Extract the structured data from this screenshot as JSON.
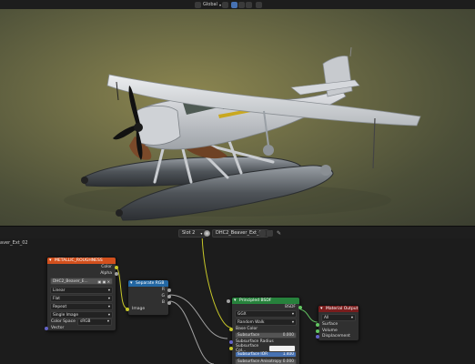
{
  "header": {
    "orientation": "Global",
    "icons": [
      "transform-icon",
      "pivot-icon",
      "snap-icon",
      "snap-toggle-icon",
      "proportional-icon"
    ]
  },
  "viewport": {
    "background_colors": [
      "#8c8650",
      "#6c6b45",
      "#3b3e30"
    ],
    "aircraft_color": "#d7d9dc"
  },
  "node_header": {
    "slot": "Slot 2",
    "material": "DHC2_Beaver_Ext_02",
    "user_count": "2",
    "material_label": "aver_Ext_02"
  },
  "nodes": {
    "image_texture": {
      "title": "METALLIC_ROUGHNESS",
      "title_color": "#d2501d",
      "outputs": [
        "Color",
        "Alpha"
      ],
      "image_name": "DHC2_Beaver_E...",
      "interpolation": "Linear",
      "projection": "Flat",
      "extension": "Repeat",
      "source": "Single Image",
      "color_space_label": "Color Space",
      "color_space": "sRGB",
      "input": "Vector"
    },
    "separate_rgb": {
      "title": "Separate RGB",
      "title_color": "#2367a3",
      "outputs": [
        "R",
        "G",
        "B"
      ],
      "input": "Image"
    },
    "principled": {
      "title": "Principled BSDF",
      "title_color": "#27823c",
      "output": "BSDF",
      "distribution": "GGX",
      "subsurface_method": "Random Walk",
      "rows": [
        {
          "label": "Base Color",
          "value": ""
        },
        {
          "label": "Subsurface",
          "value": "0.000"
        },
        {
          "label": "Subsurface Radius",
          "value": ""
        },
        {
          "label": "Subsurface Col...",
          "value": ""
        },
        {
          "label": "Subsurface IOR",
          "value": "1.400"
        },
        {
          "label": "Subsurface Anisotropy",
          "value": "0.000"
        }
      ]
    },
    "material_output": {
      "title": "Material Output",
      "title_color": "#7a1d1d",
      "target": "All",
      "inputs": [
        "Surface",
        "Volume",
        "Displacement"
      ]
    }
  }
}
